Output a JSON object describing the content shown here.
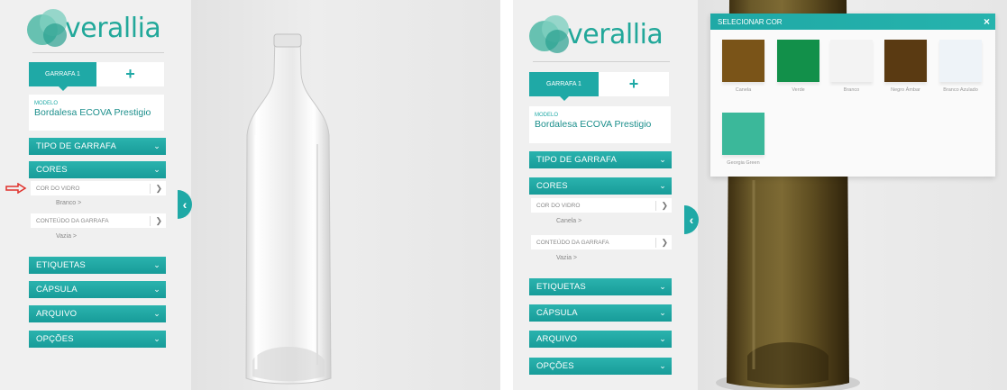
{
  "left": {
    "brand": "verallia",
    "tab_active": "GARRAFA 1",
    "tab_add": "+",
    "model_label": "MODELO",
    "model_value": "Bordalesa ECOVA Prestigio",
    "sections": {
      "tipo": "TIPO DE GARRAFA",
      "cores": "CORES",
      "etiquetas": "ETIQUETAS",
      "capsula": "CÁPSULA",
      "arquivo": "ARQUIVO",
      "opcoes": "OPÇÕES"
    },
    "sub_cor": "COR DO VIDRO",
    "sub_cor_value": "Branco  >",
    "sub_conteudo": "CONTEÚDO DA GARRAFA",
    "sub_conteudo_value": "Vazia  >",
    "chevron": "❯",
    "collapse": "‹"
  },
  "right": {
    "brand": "verallia",
    "tab_active": "GARRAFA 1",
    "tab_add": "+",
    "model_label": "MODELO",
    "model_value": "Bordalesa ECOVA Prestigio",
    "sections": {
      "tipo": "TIPO DE GARRAFA",
      "cores": "CORES",
      "etiquetas": "ETIQUETAS",
      "capsula": "CÁPSULA",
      "arquivo": "ARQUIVO",
      "opcoes": "OPÇÕES"
    },
    "sub_cor": "COR DO VIDRO",
    "sub_cor_value": "Canela  >",
    "sub_conteudo": "CONTEÚDO DA GARRAFA",
    "sub_conteudo_value": "Vazia  >",
    "collapse": "‹",
    "dialog": {
      "title": "SELECIONAR COR",
      "close": "×",
      "swatches": [
        {
          "name": "Canela",
          "color": "#7a5418"
        },
        {
          "name": "Verde",
          "color": "#12904a"
        },
        {
          "name": "Branco",
          "color": "#f3f3f3"
        },
        {
          "name": "Negro Âmbar",
          "color": "#5a3a12"
        },
        {
          "name": "Branco Azulado",
          "color": "#eef3f8"
        },
        {
          "name": "Georgia Green",
          "color": "#3bb89a"
        }
      ]
    }
  },
  "colors": {
    "accent": "#1fa9a6",
    "indicator_arrow": "#e0312b"
  }
}
